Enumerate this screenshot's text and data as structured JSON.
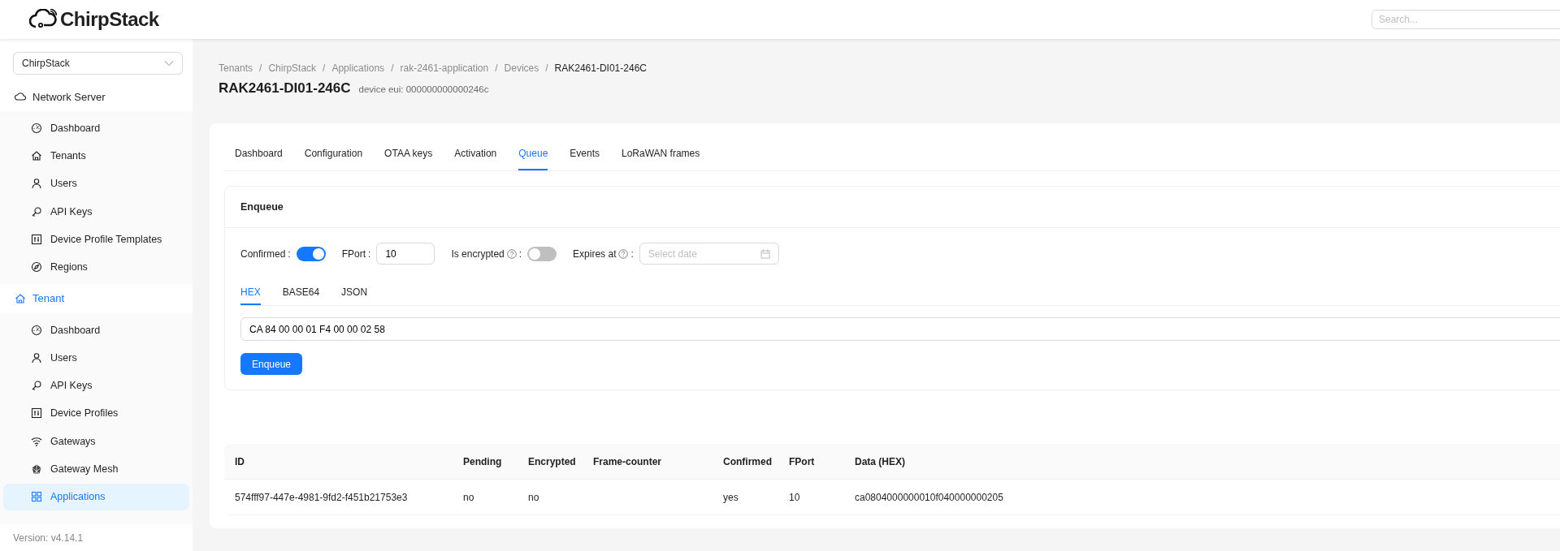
{
  "header": {
    "logo_text": "ChirpStack",
    "search": {
      "placeholder": "Search..."
    }
  },
  "sidebar": {
    "tenant_select": {
      "value": "ChirpStack"
    },
    "sections": [
      {
        "label": "Network Server",
        "active": false,
        "items": [
          {
            "label": "Dashboard",
            "selected": false
          },
          {
            "label": "Tenants",
            "selected": false
          },
          {
            "label": "Users",
            "selected": false
          },
          {
            "label": "API Keys",
            "selected": false
          },
          {
            "label": "Device Profile Templates",
            "selected": false
          },
          {
            "label": "Regions",
            "selected": false
          }
        ]
      },
      {
        "label": "Tenant",
        "active": true,
        "items": [
          {
            "label": "Dashboard",
            "selected": false
          },
          {
            "label": "Users",
            "selected": false
          },
          {
            "label": "API Keys",
            "selected": false
          },
          {
            "label": "Device Profiles",
            "selected": false
          },
          {
            "label": "Gateways",
            "selected": false
          },
          {
            "label": "Gateway Mesh",
            "selected": false
          },
          {
            "label": "Applications",
            "selected": true
          }
        ]
      }
    ],
    "version": "Version: v4.14.1"
  },
  "breadcrumb": [
    "Tenants",
    "ChirpStack",
    "Applications",
    "rak-2461-application",
    "Devices",
    "RAK2461-DI01-246C"
  ],
  "breadcrumb_separator": "/",
  "title": "RAK2461-DI01-246C",
  "subtitle": "device eui: 000000000000246c",
  "tabs": [
    {
      "label": "Dashboard",
      "selected": false
    },
    {
      "label": "Configuration",
      "selected": false
    },
    {
      "label": "OTAA keys",
      "selected": false
    },
    {
      "label": "Activation",
      "selected": false
    },
    {
      "label": "Queue",
      "selected": true
    },
    {
      "label": "Events",
      "selected": false
    },
    {
      "label": "LoRaWAN frames",
      "selected": false
    }
  ],
  "enqueue": {
    "title": "Enqueue",
    "label_separator": ":",
    "fields": [
      {
        "kind": "switch",
        "label": "Confirmed",
        "help": false,
        "on": true
      },
      {
        "kind": "input",
        "label": "FPort",
        "help": false,
        "value": "10"
      },
      {
        "kind": "switch",
        "label": "Is encrypted",
        "help": true,
        "on": false
      },
      {
        "kind": "date",
        "label": "Expires at",
        "help": true,
        "placeholder": "Select date"
      }
    ],
    "payload_tabs": [
      {
        "label": "HEX",
        "selected": true
      },
      {
        "label": "BASE64",
        "selected": false
      },
      {
        "label": "JSON",
        "selected": false
      }
    ],
    "payload": "CA 84 00 00 01 F4 00 00 02 58",
    "button": "Enqueue"
  },
  "table": {
    "columns": [
      "ID",
      "Pending",
      "Encrypted",
      "Frame-counter",
      "Confirmed",
      "FPort",
      "Data (HEX)"
    ],
    "rows": [
      [
        "574fff97-447e-4981-9fd2-f451b21753e3",
        "no",
        "no",
        "",
        "yes",
        "10",
        "ca0804000000010f040000000205"
      ]
    ]
  }
}
